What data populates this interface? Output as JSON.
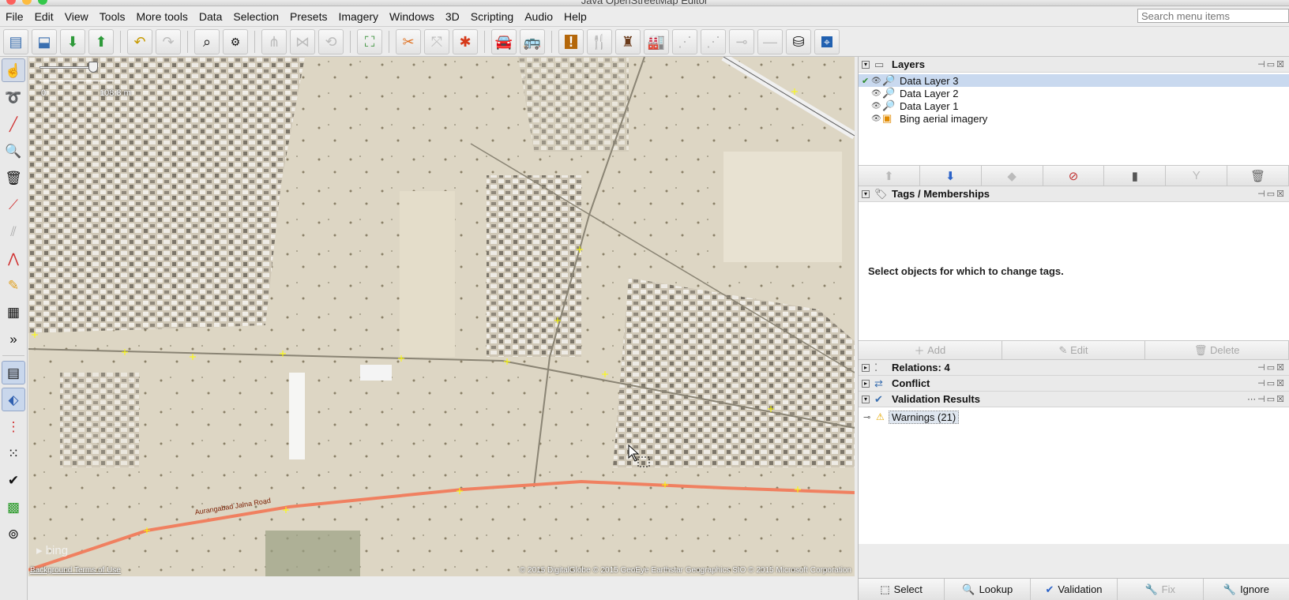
{
  "window": {
    "title": "Java OpenStreetMap Editor"
  },
  "menu": {
    "items": [
      "File",
      "Edit",
      "View",
      "Tools",
      "More tools",
      "Data",
      "Selection",
      "Presets",
      "Imagery",
      "Windows",
      "3D",
      "Scripting",
      "Audio",
      "Help"
    ],
    "search_placeholder": "Search menu items"
  },
  "map": {
    "scale_zero": "0",
    "scale_label": "108.8 m",
    "road_label": "Aurangabad Jalna Road",
    "attribution": "© 2015 DigitalGlobe © 2015 GeoEye Earthstar Geographics  SIO © 2015 Microsoft Corporation",
    "terms": "Background Terms of Use",
    "bing": "bing"
  },
  "layers": {
    "title": "Layers",
    "items": [
      {
        "name": "Data Layer 3",
        "selected": true
      },
      {
        "name": "Data Layer 2",
        "selected": false
      },
      {
        "name": "Data Layer 1",
        "selected": false
      },
      {
        "name": "Bing aerial imagery",
        "selected": false
      }
    ]
  },
  "tags": {
    "title": "Tags / Memberships",
    "empty_message": "Select objects for which to change tags.",
    "add_label": "Add",
    "edit_label": "Edit",
    "delete_label": "Delete"
  },
  "relations": {
    "title": "Relations: 4"
  },
  "conflict": {
    "title": "Conflict"
  },
  "validation": {
    "title": "Validation Results",
    "warnings_label": "Warnings (21)"
  },
  "bottom_buttons": {
    "select": "Select",
    "lookup": "Lookup",
    "validation": "Validation",
    "fix": "Fix",
    "ignore": "Ignore"
  },
  "colors": {
    "road": "#f08060",
    "selection_row": "#c9d9ef",
    "node_marker": "#ffff00"
  }
}
